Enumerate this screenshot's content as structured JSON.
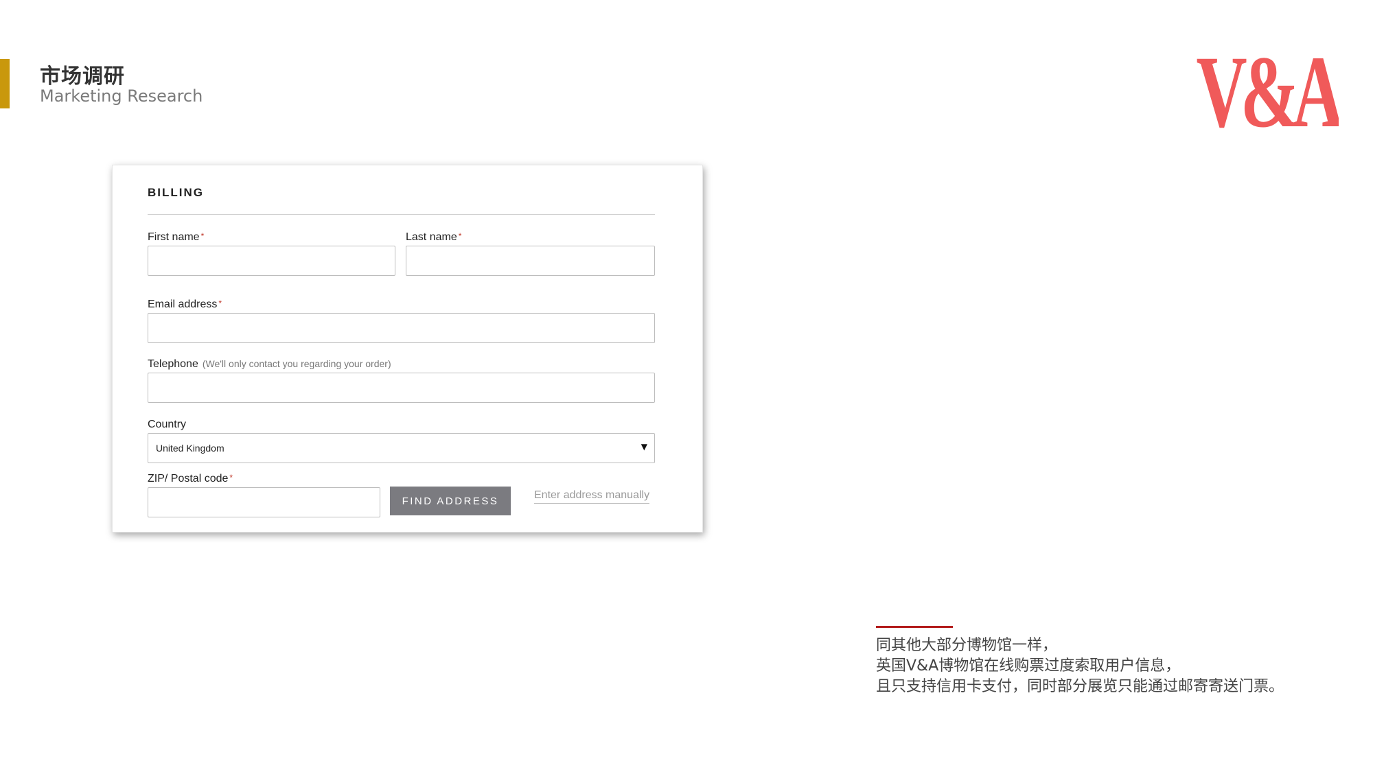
{
  "header": {
    "title": "市场调研",
    "subtitle": "Marketing Research",
    "accent_color": "#c9980c"
  },
  "logo": {
    "text": "V&A",
    "color": "#f05a5a",
    "icon": "va-logo-icon"
  },
  "billing_form": {
    "title": "BILLING",
    "first_name": {
      "label": "First name",
      "required_mark": "*",
      "value": ""
    },
    "last_name": {
      "label": "Last name",
      "required_mark": "*",
      "value": ""
    },
    "email": {
      "label": "Email address",
      "required_mark": "*",
      "value": ""
    },
    "telephone": {
      "label": "Telephone",
      "hint": "(We'll only contact you regarding your order)",
      "value": ""
    },
    "country": {
      "label": "Country",
      "selected": "United Kingdom",
      "icon": "caret-down-icon"
    },
    "postal_code": {
      "label": "ZIP/ Postal code",
      "required_mark": "*",
      "value": ""
    },
    "find_address_label": "FIND ADDRESS",
    "manual_link_label": "Enter address manually"
  },
  "note": {
    "accent_color": "#b21a1a",
    "lines": [
      "同其他大部分博物馆一样，",
      "英国V&A博物馆在线购票过度索取用户信息，",
      "且只支持信用卡支付，同时部分展览只能通过邮寄寄送门票。"
    ]
  }
}
